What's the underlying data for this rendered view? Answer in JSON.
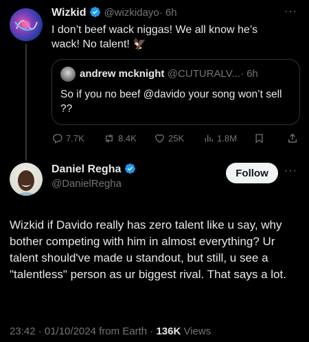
{
  "colors": {
    "background": "#000000",
    "text": "#e7e9ea",
    "muted": "#71767b",
    "verified": "#1d9bf0",
    "follow_bg": "#eff3f4"
  },
  "original_tweet": {
    "name": "Wizkid",
    "handle": "@wizkidayo",
    "time": "· 6h",
    "text": "I don’t beef wack niggas! We all know he’s wack! No talent! 🦅",
    "more": "···",
    "quoted": {
      "name": "andrew mcknight",
      "handle": "@CUTURALV...",
      "time": "· 6h",
      "text": "So if you no beef @davido your song won’t sell ??"
    },
    "actions": {
      "replies": "7.7K",
      "reposts": "8.4K",
      "likes": "25K",
      "views": "1.8M"
    },
    "icons": [
      "reply-icon",
      "repost-icon",
      "like-icon",
      "views-icon",
      "bookmark-icon",
      "share-icon"
    ]
  },
  "reply_tweet": {
    "name": "Daniel Regha",
    "handle": "@DanielRegha",
    "follow_label": "Follow",
    "more": "···",
    "text": "Wizkid if Davido really has zero talent like u say, why bother competing with him in almost everything? Ur talent should've made u standout, but still, u see a \"talentless\" person as ur biggest rival. That says a lot.",
    "timestamp": "23:42 · 01/10/2024 from Earth · ",
    "views_count": "136K",
    "views_label": " Views"
  }
}
